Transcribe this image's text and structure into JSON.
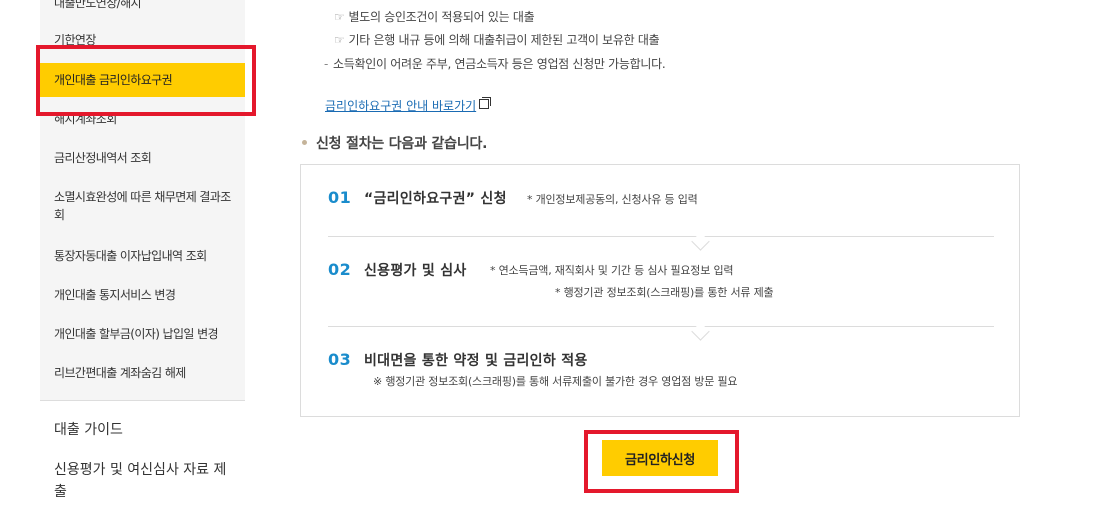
{
  "sidebar": {
    "items": [
      {
        "label": "대출만도연장/해지"
      },
      {
        "label": "기한연장"
      },
      {
        "label": "개인대출 금리인하요구권"
      },
      {
        "label": "해지계좌조회"
      },
      {
        "label": "금리산정내역서 조회"
      },
      {
        "label": "소멸시효완성에 따른 채무면제 결과조회"
      },
      {
        "label": "통장자동대출 이자납입내역 조회"
      },
      {
        "label": "개인대출 통지서비스 변경"
      },
      {
        "label": "개인대출 할부금(이자) 납입일 변경"
      },
      {
        "label": "리브간편대출 계좌숨김 해제"
      }
    ],
    "groups": [
      {
        "label": "대출 가이드"
      },
      {
        "label": "신용평가 및 여신심사 자료 제출"
      }
    ]
  },
  "notes": {
    "line1": "별도의 승인조건이 적용되어 있는 대출",
    "line2": "기타 은행 내규 등에 의해 대출취급이 제한된 고객이 보유한 대출",
    "line3": "소득확인이 어려운 주부, 연금소득자 등은 영업점 신청만 가능합니다.",
    "hand_glyph": "☞",
    "dash_glyph": "-"
  },
  "guide_link": "금리인하요구권 안내 바로가기",
  "section_title": "신청 절차는 다음과 같습니다.",
  "steps": [
    {
      "num": "01",
      "title": "“금리인하요구권” 신청",
      "desc": [
        "* 개인정보제공동의, 신청사유 등 입력"
      ]
    },
    {
      "num": "02",
      "title": "신용평가 및 심사",
      "desc": [
        "* 연소득금액, 재직회사 및 기간 등 심사 필요정보 입력",
        "* 행정기관 정보조회(스크래핑)를 통한 서류 제출"
      ]
    },
    {
      "num": "03",
      "title": "비대면을 통한 약정 및 금리인하 적용",
      "desc": [
        "※ 행정기관 정보조회(스크래핑)를 통해 서류제출이 불가한 경우 영업점 방문 필요"
      ]
    }
  ],
  "apply_button": "금리인하신청",
  "colors": {
    "accent": "#ffcc00",
    "highlight_border": "#e4182c",
    "step_number": "#1a8ccc",
    "link": "#1a6bb3"
  }
}
